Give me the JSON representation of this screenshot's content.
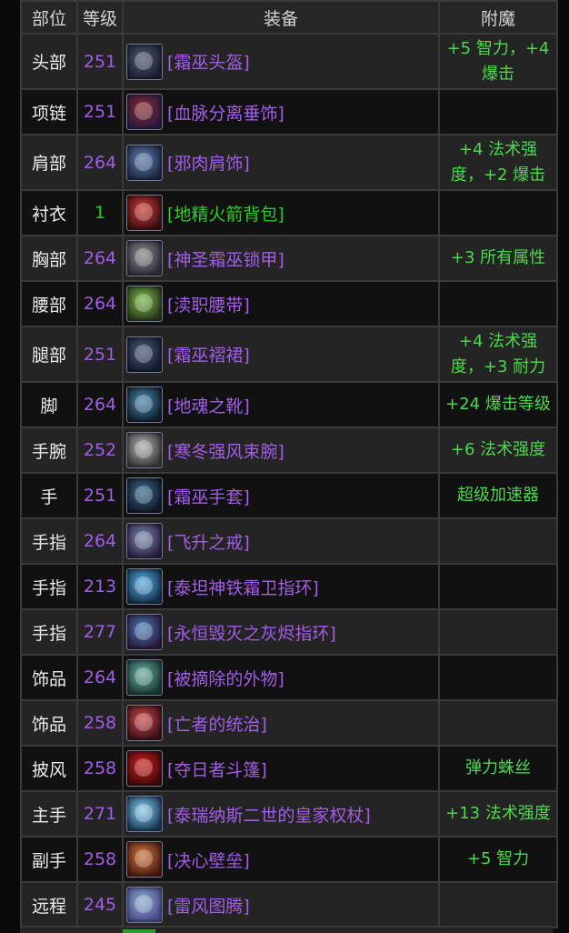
{
  "headers": {
    "slot": "部位",
    "level": "等级",
    "item": "装备",
    "enchant": "附魔"
  },
  "rows": [
    {
      "slot": "头部",
      "level": "251",
      "item": "[霜巫头盔]",
      "enchant": "+5 智力，+4 爆击",
      "quality": "epic",
      "icon": "frost-witch-helm-icon",
      "icon_colors": [
        "#4d5870",
        "#1c2030"
      ]
    },
    {
      "slot": "项链",
      "level": "251",
      "item": "[血脉分离垂饰]",
      "enchant": "",
      "quality": "epic",
      "icon": "pendant-icon",
      "icon_colors": [
        "#8a2a2a",
        "#2a1a40"
      ]
    },
    {
      "slot": "肩部",
      "level": "264",
      "item": "[邪肉肩饰]",
      "enchant": "+4 法术强度，+2 爆击",
      "quality": "epic",
      "icon": "shoulders-icon",
      "icon_colors": [
        "#5c7cae",
        "#1e2a45"
      ]
    },
    {
      "slot": "衬衣",
      "level": "1",
      "item": "[地精火箭背包]",
      "enchant": "",
      "quality": "uncommon",
      "icon": "rocket-pack-icon",
      "icon_colors": [
        "#d23a3a",
        "#3a1010"
      ]
    },
    {
      "slot": "胸部",
      "level": "264",
      "item": "[神圣霜巫锁甲]",
      "enchant": "+3 所有属性",
      "quality": "epic",
      "icon": "chest-armor-icon",
      "icon_colors": [
        "#8a8a8a",
        "#2e2e3a"
      ]
    },
    {
      "slot": "腰部",
      "level": "264",
      "item": "[渎职腰带]",
      "enchant": "",
      "quality": "epic",
      "icon": "belt-icon",
      "icon_colors": [
        "#7ab84a",
        "#2a3a1a"
      ]
    },
    {
      "slot": "腿部",
      "level": "251",
      "item": "[霜巫褶裙]",
      "enchant": "+4 法术强度，+3 耐力",
      "quality": "epic",
      "icon": "kilt-icon",
      "icon_colors": [
        "#4a5a7a",
        "#141c2c"
      ]
    },
    {
      "slot": "脚",
      "level": "264",
      "item": "[地魂之靴]",
      "enchant": "+24 爆击等级",
      "quality": "epic",
      "icon": "boots-icon",
      "icon_colors": [
        "#4a8ab0",
        "#102030"
      ]
    },
    {
      "slot": "手腕",
      "level": "252",
      "item": "[寒冬强风束腕]",
      "enchant": "+6 法术强度",
      "quality": "epic",
      "icon": "bracers-icon",
      "icon_colors": [
        "#b0b0b0",
        "#3a3a3a"
      ]
    },
    {
      "slot": "手",
      "level": "251",
      "item": "[霜巫手套]",
      "enchant": "超级加速器",
      "quality": "epic",
      "icon": "gloves-icon",
      "icon_colors": [
        "#3a6a8a",
        "#101a2a"
      ]
    },
    {
      "slot": "手指",
      "level": "264",
      "item": "[飞升之戒]",
      "enchant": "",
      "quality": "epic",
      "icon": "ring-icon",
      "icon_colors": [
        "#7a8ab0",
        "#2a2040"
      ]
    },
    {
      "slot": "手指",
      "level": "213",
      "item": "[泰坦神铁霜卫指环]",
      "enchant": "",
      "quality": "epic",
      "icon": "ring-icon",
      "icon_colors": [
        "#5ab0e8",
        "#14304a"
      ]
    },
    {
      "slot": "手指",
      "level": "277",
      "item": "[永恒毁灭之灰烬指环]",
      "enchant": "",
      "quality": "epic",
      "icon": "ring-icon",
      "icon_colors": [
        "#4a7ab8",
        "#2a1a3a"
      ]
    },
    {
      "slot": "饰品",
      "level": "264",
      "item": "[被摘除的外物]",
      "enchant": "",
      "quality": "epic",
      "icon": "trinket-icon",
      "icon_colors": [
        "#6ab0a0",
        "#1a3a34"
      ]
    },
    {
      "slot": "饰品",
      "level": "258",
      "item": "[亡者的统治]",
      "enchant": "",
      "quality": "epic",
      "icon": "trinket-icon",
      "icon_colors": [
        "#d04a4a",
        "#3a1018"
      ]
    },
    {
      "slot": "披风",
      "level": "258",
      "item": "[夺日者斗篷]",
      "enchant": "弹力蛛丝",
      "quality": "epic",
      "icon": "cloak-icon",
      "icon_colors": [
        "#d02020",
        "#400808"
      ]
    },
    {
      "slot": "主手",
      "level": "271",
      "item": "[泰瑞纳斯二世的皇家权杖]",
      "enchant": "+13 法术强度",
      "quality": "epic",
      "icon": "scepter-icon",
      "icon_colors": [
        "#8ad0f0",
        "#1a3a5a"
      ]
    },
    {
      "slot": "副手",
      "level": "258",
      "item": "[决心壁垒]",
      "enchant": "+5 智力",
      "quality": "epic",
      "icon": "shield-icon",
      "icon_colors": [
        "#d0783a",
        "#4a1a10"
      ]
    },
    {
      "slot": "远程",
      "level": "245",
      "item": "[雷风图腾]",
      "enchant": "",
      "quality": "epic",
      "icon": "totem-icon",
      "icon_colors": [
        "#8ab0d0",
        "#4a4a8a"
      ]
    }
  ]
}
